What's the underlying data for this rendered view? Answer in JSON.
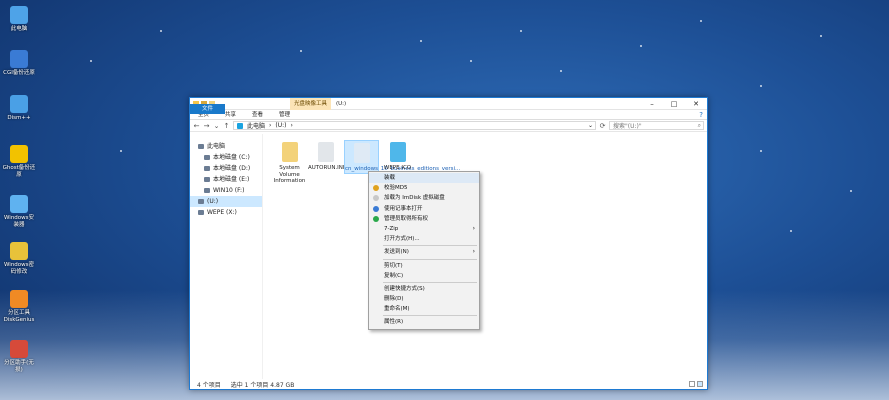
{
  "desktop_icons": [
    {
      "label": "此电脑",
      "icon": "computer-icon",
      "color": "#4ea3e8"
    },
    {
      "label": "CGI备份还原",
      "icon": "backup-icon",
      "color": "#3a7bd5"
    },
    {
      "label": "Dism++",
      "icon": "gear-icon",
      "color": "#4aa0e6"
    },
    {
      "label": "Ghost备份还原",
      "icon": "ghost-icon",
      "color": "#f2c200"
    },
    {
      "label": "Windows安装器",
      "icon": "installer-icon",
      "color": "#5fb2f0"
    },
    {
      "label": "Windows密码修改",
      "icon": "key-icon",
      "color": "#e8c23a"
    },
    {
      "label": "分区工具DiskGenius",
      "icon": "diskgenius-icon",
      "color": "#f08a24"
    },
    {
      "label": "分区助手(无损)",
      "icon": "partition-icon",
      "color": "#d64a3a"
    }
  ],
  "window": {
    "context_tab": "光盘映像工具",
    "title": "(U:)",
    "ribbon_tabs": [
      "文件",
      "主页",
      "共享",
      "查看",
      "管理"
    ],
    "breadcrumb": [
      "此电脑",
      "(U:)"
    ],
    "search_placeholder": "搜索\"(U:)\""
  },
  "tree": [
    {
      "label": "此电脑",
      "child": false,
      "selected": false
    },
    {
      "label": "本地磁盘 (C:)",
      "child": true,
      "selected": false
    },
    {
      "label": "本地磁盘 (D:)",
      "child": true,
      "selected": false
    },
    {
      "label": "本地磁盘 (E:)",
      "child": true,
      "selected": false
    },
    {
      "label": "WIN10 (F:)",
      "child": true,
      "selected": false
    },
    {
      "label": "(U:)",
      "child": false,
      "selected": true
    },
    {
      "label": "WEPE (X:)",
      "child": false,
      "selected": false
    }
  ],
  "files": [
    {
      "label": "System Volume Information",
      "icon": "folder-icon",
      "color": "#f3d27a",
      "selected": false
    },
    {
      "label": "AUTORUN.INF",
      "icon": "file-icon",
      "color": "#e2e6ea",
      "selected": false
    },
    {
      "label": "cn_windows_10_business_editions_versi...",
      "icon": "disc-image-icon",
      "color": "#dfeaf5",
      "selected": true
    },
    {
      "label": "WEPE.ICO",
      "icon": "disc-icon",
      "color": "#4fb7ea",
      "selected": false
    }
  ],
  "status": {
    "count": "4 个项目",
    "selected": "选中 1 个项目 4.87 GB"
  },
  "context_menu": [
    {
      "label": "装载",
      "icon": "",
      "arrow": false,
      "highlight": true,
      "sep_after": false
    },
    {
      "label": "校验MD5",
      "icon": "#e0a21e",
      "arrow": false,
      "highlight": false,
      "sep_after": false
    },
    {
      "label": "加载为 ImDisk 虚拟磁盘",
      "icon": "#c8c8c8",
      "arrow": false,
      "highlight": false,
      "sep_after": false
    },
    {
      "label": "使用记事本打开",
      "icon": "#3a7bd5",
      "arrow": false,
      "highlight": false,
      "sep_after": false
    },
    {
      "label": "管理员取得所有权",
      "icon": "#2aa84a",
      "arrow": false,
      "highlight": false,
      "sep_after": false
    },
    {
      "label": "7-Zip",
      "icon": "",
      "arrow": true,
      "highlight": false,
      "sep_after": false
    },
    {
      "label": "打开方式(H)...",
      "icon": "",
      "arrow": false,
      "highlight": false,
      "sep_after": true
    },
    {
      "label": "发送到(N)",
      "icon": "",
      "arrow": true,
      "highlight": false,
      "sep_after": true
    },
    {
      "label": "剪切(T)",
      "icon": "",
      "arrow": false,
      "highlight": false,
      "sep_after": false
    },
    {
      "label": "复制(C)",
      "icon": "",
      "arrow": false,
      "highlight": false,
      "sep_after": true
    },
    {
      "label": "创建快捷方式(S)",
      "icon": "",
      "arrow": false,
      "highlight": false,
      "sep_after": false
    },
    {
      "label": "删除(D)",
      "icon": "",
      "arrow": false,
      "highlight": false,
      "sep_after": false
    },
    {
      "label": "重命名(M)",
      "icon": "",
      "arrow": false,
      "highlight": false,
      "sep_after": true
    },
    {
      "label": "属性(R)",
      "icon": "",
      "arrow": false,
      "highlight": false,
      "sep_after": false
    }
  ]
}
